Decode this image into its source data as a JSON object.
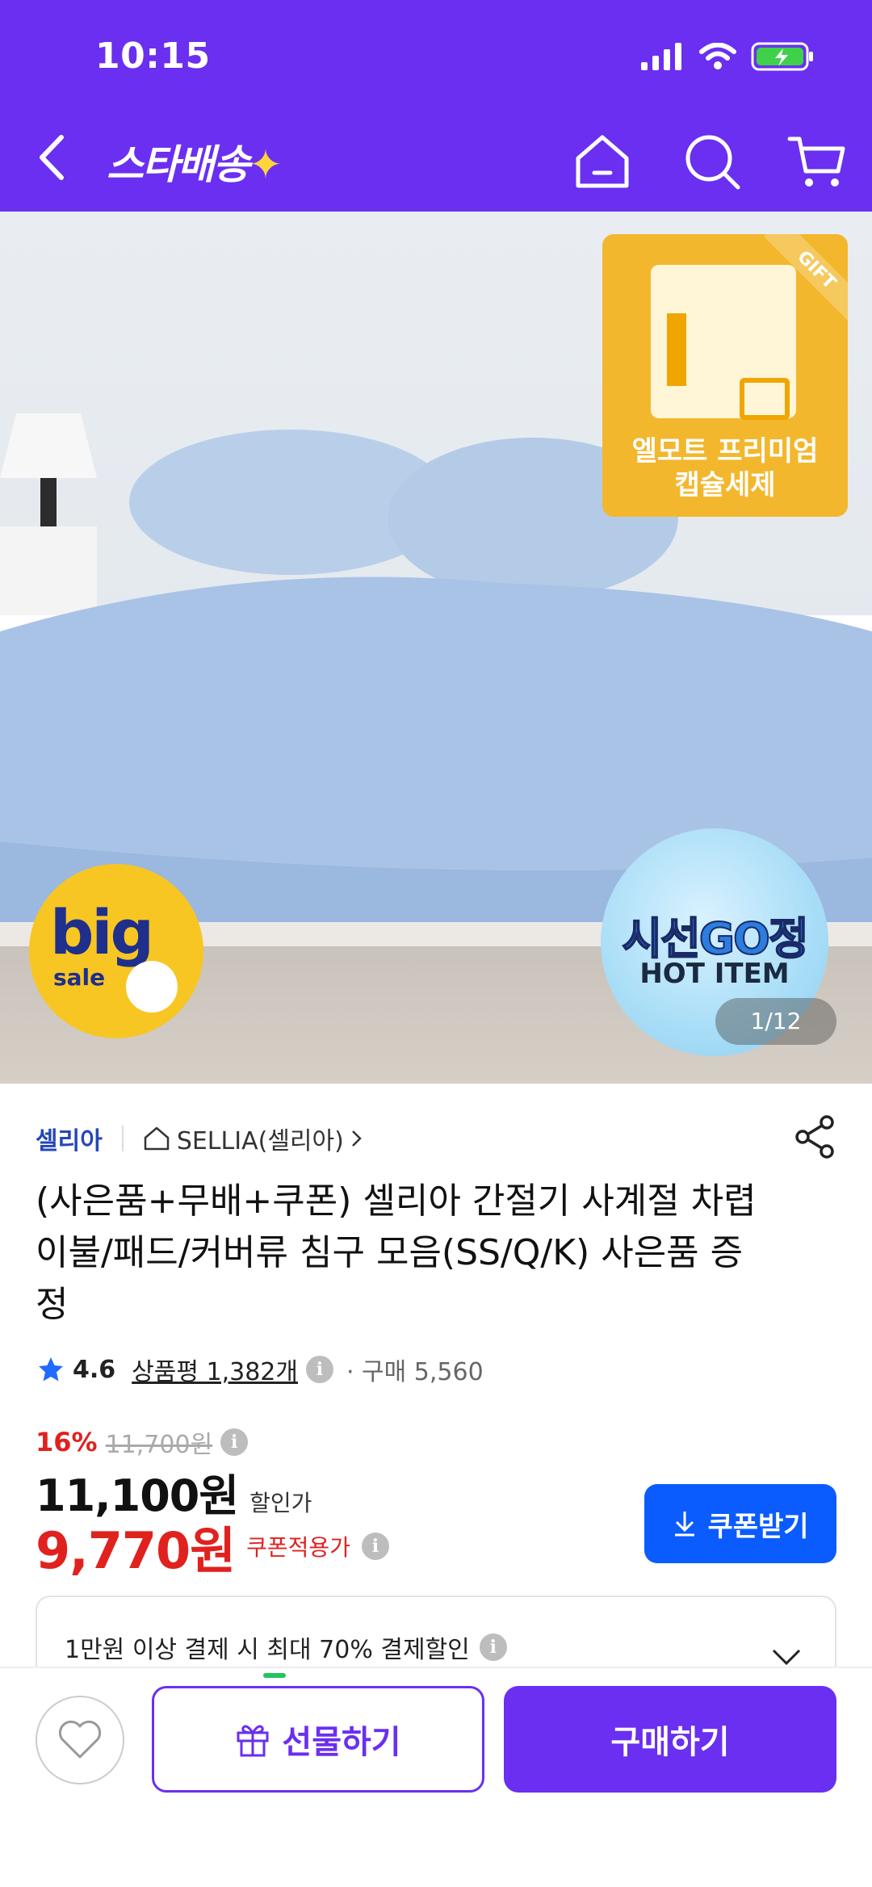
{
  "status_bar": {
    "time": "10:15"
  },
  "header": {
    "brand": "스타배송",
    "brand_star": "✦"
  },
  "hero": {
    "gift_tag": "GIFT",
    "gift_caption_line1": "엘모트 프리미엄",
    "gift_caption_line2": "캡슐세제",
    "badge_big": "big",
    "badge_sale": "sale",
    "badge_hot_line1": "시선GO정",
    "badge_hot_line2": "HOT ITEM",
    "pager": "1/12"
  },
  "product": {
    "seller": "셀리아",
    "store": "SELLIA(셀리아)",
    "title": "(사은품+무배+쿠폰) 셀리아 간절기 사계절 차렵이불/패드/커버류 침구 모음(SS/Q/K) 사은품 증정",
    "rating": "4.6",
    "reviews": "상품평 1,382개",
    "buys": "· 구매 5,560",
    "discount_pct": "16%",
    "original_price": "11,700원",
    "price": "11,100원",
    "price_label": "할인가",
    "coupon_price": "9,770원",
    "coupon_label": "쿠폰적용가",
    "coupon_button": "쿠폰받기",
    "benefit_text": "1만원 이상 결제 시 최대  70% 결제할인"
  },
  "bottom_bar": {
    "gift_button": "선물하기",
    "buy_button": "구매하기"
  },
  "colors": {
    "brand_purple": "#6a2ff0",
    "coupon_blue": "#0b5cff",
    "sale_red": "#e0221f"
  }
}
